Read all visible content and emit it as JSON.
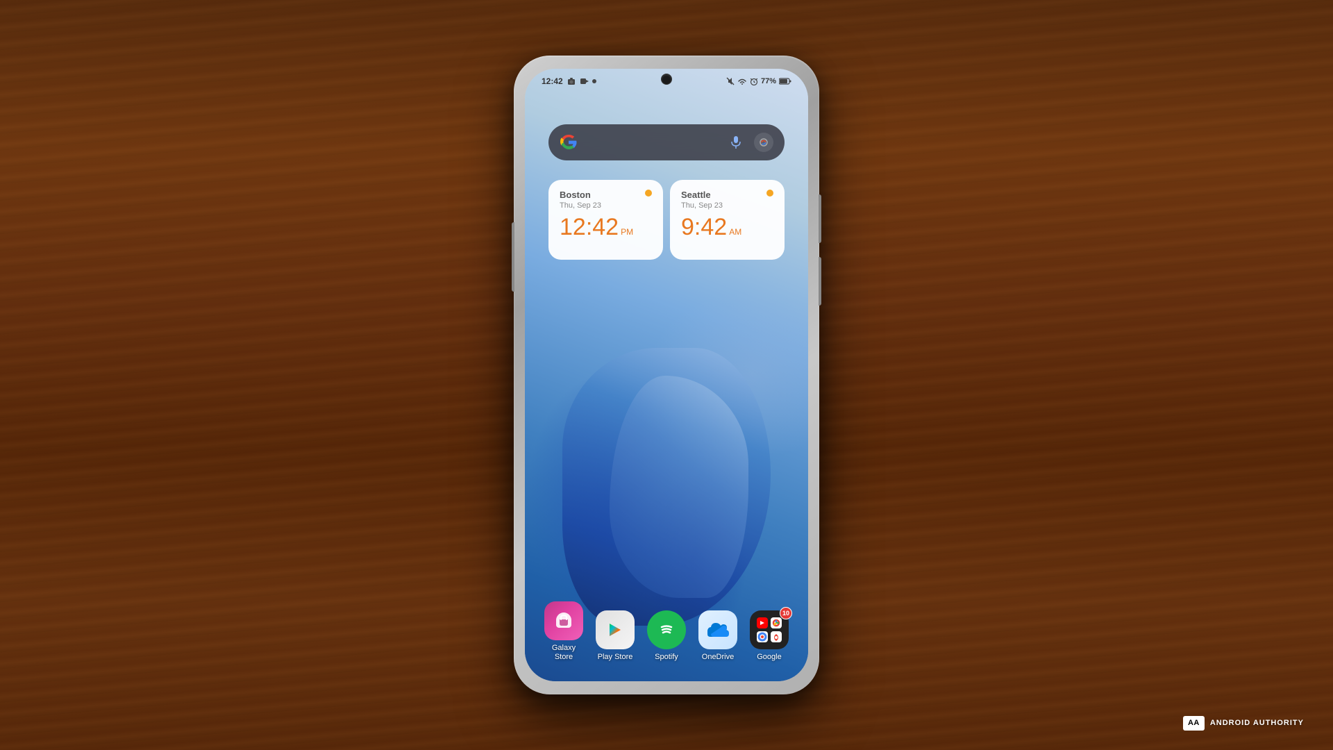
{
  "background": {
    "wood_color": "#5a2808"
  },
  "phone": {
    "status_bar": {
      "time": "12:42",
      "signal_icon": "signal-icon",
      "wifi_icon": "wifi-icon",
      "alarm_icon": "alarm-icon",
      "battery_percent": "77%",
      "battery_icon": "battery-icon",
      "mute_icon": "mute-icon"
    },
    "search_widget": {
      "google_logo": "google-g-icon",
      "mic_icon": "mic-icon",
      "lens_icon": "lens-icon"
    },
    "clock_widgets": [
      {
        "city": "Boston",
        "date": "Thu, Sep 23",
        "time": "12:42",
        "ampm": "PM",
        "weather_dot": "sunny"
      },
      {
        "city": "Seattle",
        "date": "Thu, Sep 23",
        "time": "9:42",
        "ampm": "AM",
        "weather_dot": "sunny"
      }
    ],
    "dock_apps": [
      {
        "id": "galaxy-store",
        "label": "Galaxy\nStore",
        "label_line1": "Galaxy",
        "label_line2": "Store",
        "badge": null
      },
      {
        "id": "play-store",
        "label": "Play Store",
        "label_line1": "Play Store",
        "label_line2": "",
        "badge": null
      },
      {
        "id": "spotify",
        "label": "Spotify",
        "label_line1": "Spotify",
        "label_line2": "",
        "badge": null
      },
      {
        "id": "onedrive",
        "label": "OneDrive",
        "label_line1": "OneDrive",
        "label_line2": "",
        "badge": null
      },
      {
        "id": "google",
        "label": "Google",
        "label_line1": "Google",
        "label_line2": "",
        "badge": "10"
      }
    ]
  },
  "watermark": {
    "aa_label": "AA",
    "text": "ANDROID AUTHORITY"
  }
}
